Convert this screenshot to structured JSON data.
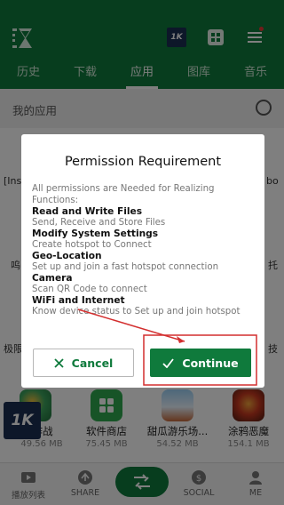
{
  "header": {
    "logo_icon": "app-logo-x-icon",
    "badge_text": "1K",
    "tabs": [
      {
        "label": "历史"
      },
      {
        "label": "下载"
      },
      {
        "label": "应用"
      },
      {
        "label": "图库"
      },
      {
        "label": "音乐"
      }
    ],
    "active_tab": 2,
    "brand_color": "#0f7a3c"
  },
  "myapps": {
    "label": "我的应用"
  },
  "background_fragments": {
    "left_ins": "[Ins",
    "right_bo": "bo",
    "left_xia": "呜",
    "right_tuo": "托",
    "left_ji": "极限",
    "right_ji": "技"
  },
  "apps": [
    {
      "name": "作战",
      "size": "49.56 MB"
    },
    {
      "name": "软件商店",
      "size": "75.45 MB"
    },
    {
      "name": "甜瓜游乐场...",
      "size": "54.52 MB"
    },
    {
      "name": "涂鸦恶魔",
      "size": "154.1 MB"
    }
  ],
  "bottom_nav": [
    {
      "label": "播放列表"
    },
    {
      "label": "SHARE"
    },
    {
      "label": "SOCIAL"
    },
    {
      "label": "ME"
    }
  ],
  "float_badge": "1K",
  "dialog": {
    "title": "Permission Requirement",
    "intro": "All permissions are Needed for Realizing Functions:",
    "permissions": [
      {
        "title": "Read and Write Files",
        "desc": "Send, Receive and Store Files"
      },
      {
        "title": "Modify System Settings",
        "desc": "Create hotspot to Connect"
      },
      {
        "title": "Geo-Location",
        "desc": "Set up and join a fast hotspot connection"
      },
      {
        "title": "Camera",
        "desc": "Scan QR Code to connect"
      },
      {
        "title": "WiFi and Internet",
        "desc": "Know device status to Set up and join hotspot"
      }
    ],
    "cancel_label": "Cancel",
    "continue_label": "Continue"
  },
  "annotation_color": "#d32f2f"
}
